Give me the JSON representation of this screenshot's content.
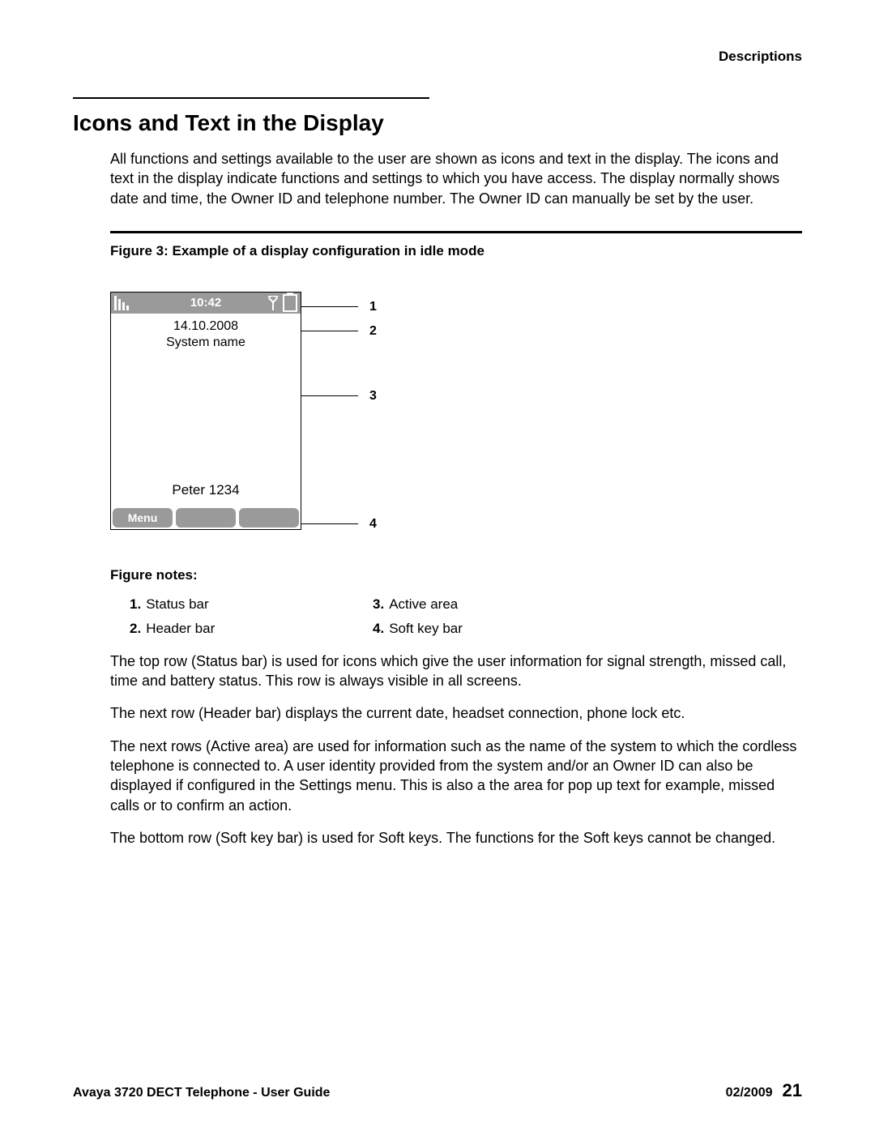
{
  "header": {
    "section": "Descriptions"
  },
  "section": {
    "title": "Icons and Text in the Display",
    "intro": "All functions and settings available to the user are shown as icons and text in the display. The icons and text in the display indicate functions and settings to which you have access. The display normally shows date and time, the Owner ID and telephone number. The Owner ID can manually be set by the user."
  },
  "figure": {
    "caption": "Figure 3: Example of a display configuration in idle mode",
    "status_bar": {
      "time": "10:42"
    },
    "header_bar": {
      "date": "14.10.2008",
      "system_name": "System name"
    },
    "active_area": {
      "owner": "Peter 1234"
    },
    "softkeys": {
      "left": "Menu",
      "center": "",
      "right": ""
    },
    "callouts": {
      "c1": "1",
      "c2": "2",
      "c3": "3",
      "c4": "4"
    }
  },
  "figure_notes": {
    "caption": "Figure notes:",
    "items": {
      "n1": {
        "num": "1.",
        "label": "Status bar"
      },
      "n2": {
        "num": "2.",
        "label": "Header bar"
      },
      "n3": {
        "num": "3.",
        "label": "Active area"
      },
      "n4": {
        "num": "4.",
        "label": "Soft key bar"
      }
    }
  },
  "body": {
    "p1": "The top row (Status bar) is used for icons which give the user information for signal strength, missed call, time and battery status. This row is always visible in all screens.",
    "p2": "The next row (Header bar) displays the current date, headset connection, phone lock etc.",
    "p3": "The next rows (Active area) are used for information such as the name of the system to which the cordless telephone is connected to. A user identity provided from the system and/or an Owner ID can also be displayed if configured in the Settings menu. This is also a the area for pop up text for example, missed calls or to confirm an action.",
    "p4": "The bottom row (Soft key bar) is used for Soft keys. The functions for the Soft keys cannot be changed."
  },
  "footer": {
    "doc": "Avaya 3720 DECT Telephone - User Guide",
    "date": "02/2009",
    "page": "21"
  }
}
